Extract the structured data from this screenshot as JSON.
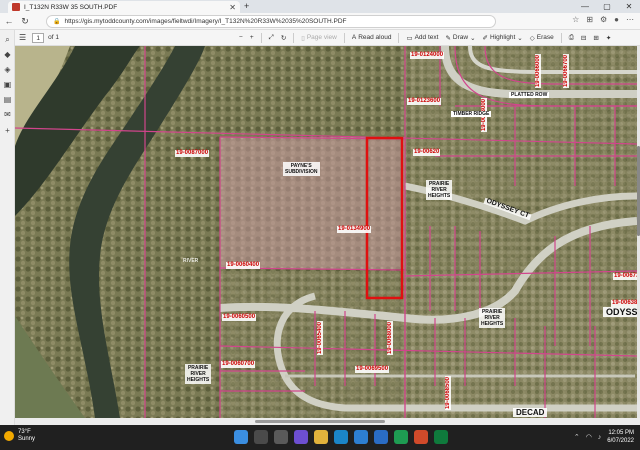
{
  "browser": {
    "tab_title": "I_T132N R33W 35 SOUTH.PDF",
    "url": "https://gis.mytoddcounty.com/images/fieltwdi/Imagery/I_T132N%20R33W%2035%20SOUTH.PDF",
    "lock_icon": "lock-icon"
  },
  "pdf_toolbar": {
    "page_number": "1",
    "page_total": "of 1",
    "page_view": "Page view",
    "read_aloud": "Read aloud",
    "add_text": "Add text",
    "draw": "Draw",
    "highlight": "Highlight",
    "erase": "Erase"
  },
  "map": {
    "parcel_labels": [
      "19-0087000",
      "19-0134900",
      "19-0123600",
      "19-0124000",
      "19-0060400",
      "19-0060500",
      "19-0060700",
      "19-00620",
      "19-00673",
      "19-0063800",
      "19-0069500"
    ],
    "vertical_labels": [
      "19-0083000",
      "19-0066000",
      "19-0066700",
      "19-0065400",
      "19-0068000",
      "19-0068500"
    ],
    "subdivisions": [
      {
        "name": "PAYNE'S\nSUBDIVISION"
      },
      {
        "name": "PRAIRIE\nRIVER\nHEIGHTS"
      },
      {
        "name": "PRAIRIE\nRIVER\nHEIGHTS"
      },
      {
        "name": "PRAIRIE\nRIVER\nHEIGHTS"
      }
    ],
    "streets": [
      "TIMBER RIDGE",
      "PLATTED ROW",
      "ODYSSEY CT",
      "ODYSSE",
      "DECAD"
    ],
    "river_label": "RIVER",
    "highlight_color": "#e01010"
  },
  "taskbar": {
    "temperature": "73°F",
    "weather": "Sunny",
    "time": "12:05 PM",
    "date": "6/07/2022"
  }
}
